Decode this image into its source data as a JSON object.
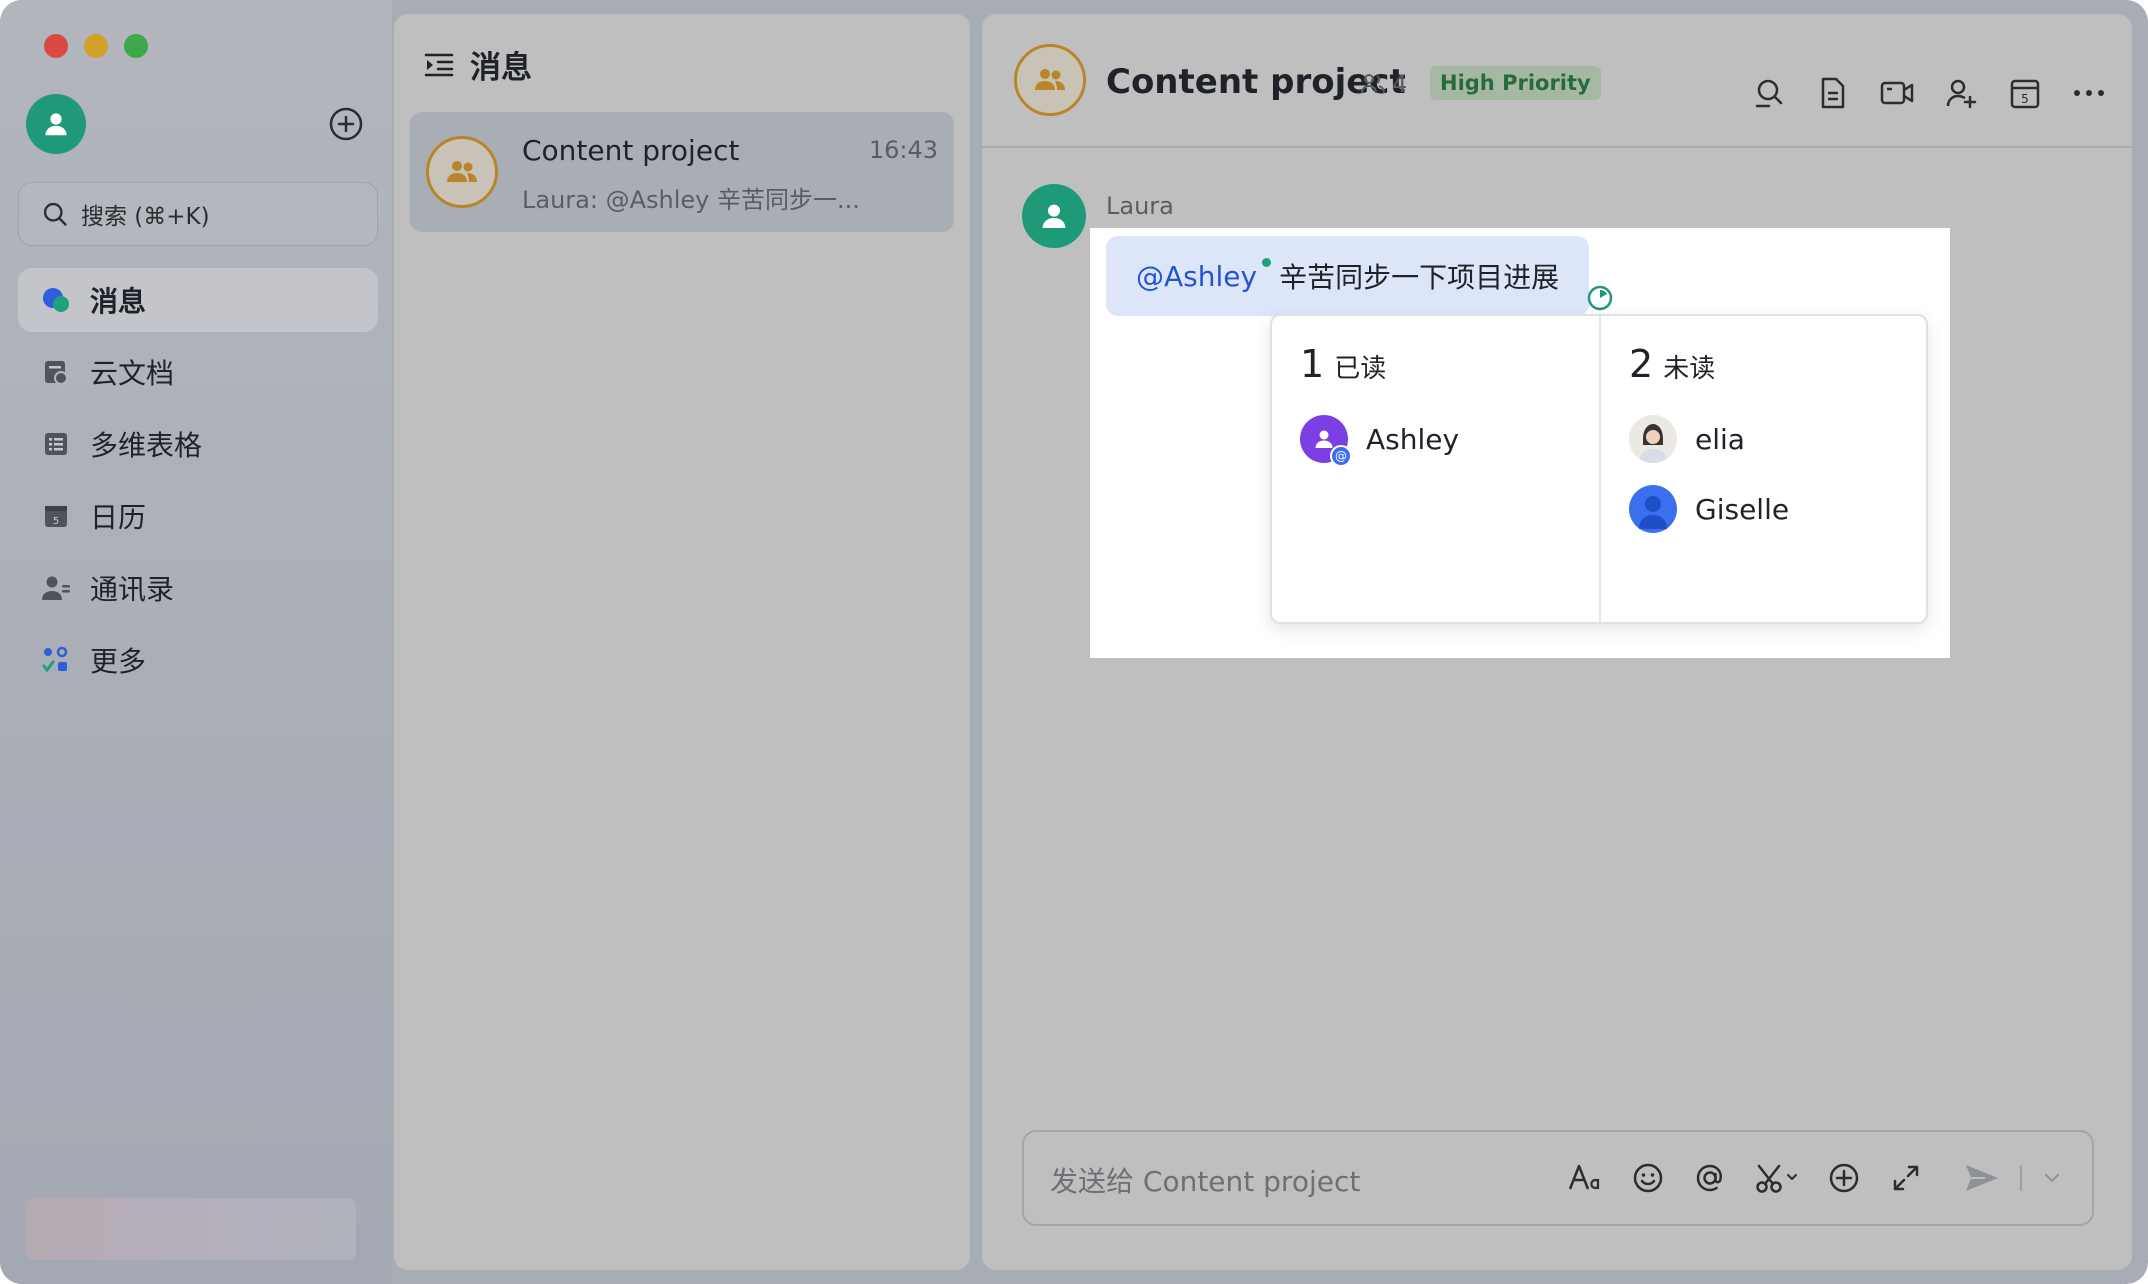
{
  "sidebar": {
    "search_placeholder": "搜索 (⌘+K)",
    "items": [
      {
        "label": "消息",
        "icon": "chat-bubble-icon",
        "active": true
      },
      {
        "label": "云文档",
        "icon": "cloud-doc-icon",
        "active": false
      },
      {
        "label": "多维表格",
        "icon": "table-icon",
        "active": false
      },
      {
        "label": "日历",
        "icon": "calendar-icon",
        "active": false
      },
      {
        "label": "通讯录",
        "icon": "contacts-icon",
        "active": false
      },
      {
        "label": "更多",
        "icon": "apps-grid-icon",
        "active": false
      }
    ],
    "calendar_icon_day": "5"
  },
  "list": {
    "header": "消息",
    "conversations": [
      {
        "title": "Content project",
        "time": "16:43",
        "preview": "Laura: @Ashley 辛苦同步一..."
      }
    ]
  },
  "chat": {
    "title": "Content project",
    "member_count": "4",
    "priority_tag": "High Priority",
    "header_calendar_day": "5",
    "message": {
      "sender": "Laura",
      "mention": "@Ashley",
      "text": "辛苦同步一下项目进展"
    },
    "read_popup": {
      "read_count": "1",
      "read_label": "已读",
      "read_users": [
        "Ashley"
      ],
      "unread_count": "2",
      "unread_label": "未读",
      "unread_users": [
        "elia",
        "Giselle"
      ]
    },
    "composer_placeholder": "发送给 Content project"
  },
  "colors": {
    "accent_green": "#1f9a78",
    "mention_blue": "#2453d6",
    "priority_text": "#276b3d",
    "group_avatar_ring": "#b88528"
  }
}
